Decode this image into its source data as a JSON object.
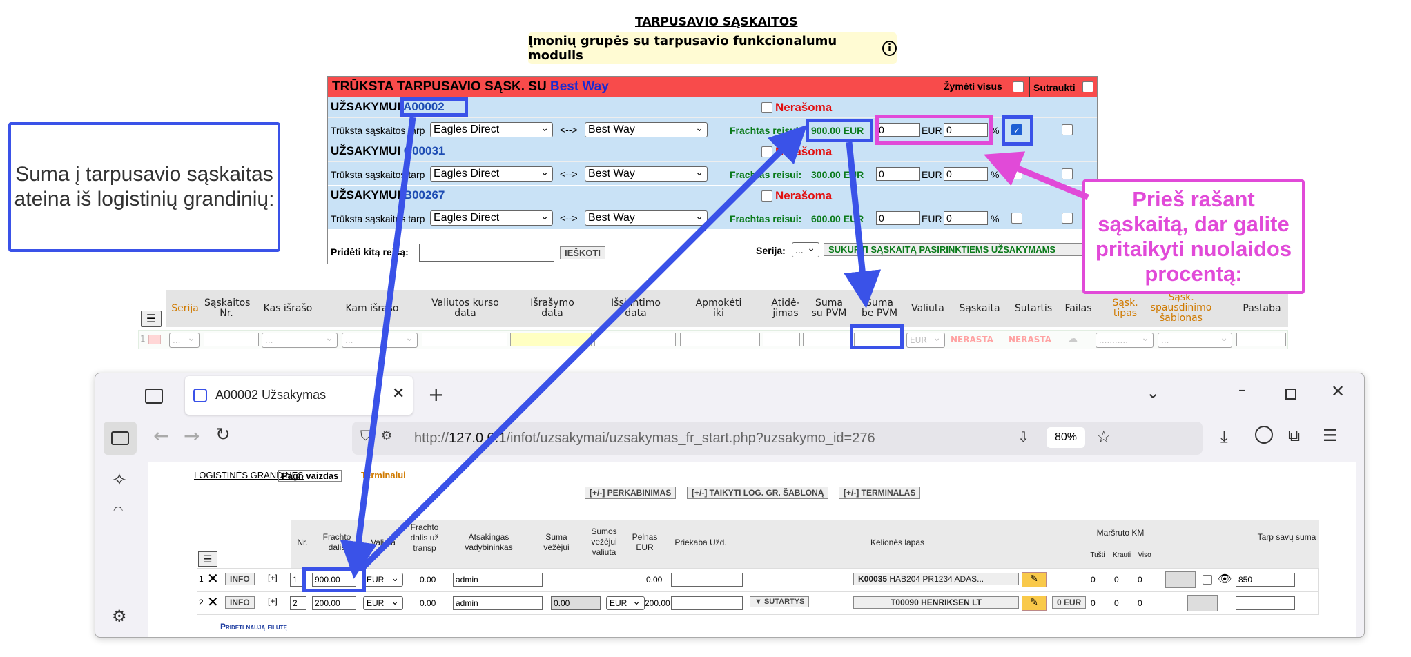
{
  "top": {
    "title": "TARPUSAVIO SĄSKAITOS",
    "notice": "Įmonių grupės su tarpusavio funkcionalumu modulis",
    "info_icon": "info-icon"
  },
  "panel": {
    "header_prefix": "TRŪKSTA TARPUSAVIO SĄSK. SU",
    "header_company": "Best Way",
    "mark_all": "Žymėti visus",
    "collapse": "Sutraukti",
    "orders": [
      {
        "label": "UŽSAKYMUI",
        "code": "A00002",
        "status": "Nerašoma",
        "row_label": "Trūksta sąskaitos tarp",
        "from": "Eagles Direct",
        "arrow": "<-->",
        "to": "Best Way",
        "freight_label": "Frachtas reisui:",
        "freight_value": "900.00 EUR",
        "eur_value": "0",
        "eur_unit": "EUR",
        "pct_value": "0",
        "pct_unit": "%",
        "checked": true
      },
      {
        "label": "UŽSAKYMUI",
        "code": "C00031",
        "status": "Nerašoma",
        "row_label": "Trūksta sąskaitos tarp",
        "from": "Eagles Direct",
        "arrow": "<-->",
        "to": "Best Way",
        "freight_label": "Frachtas reisui:",
        "freight_value": "300.00 EUR",
        "eur_value": "0",
        "eur_unit": "EUR",
        "pct_value": "0",
        "pct_unit": "%",
        "checked": false
      },
      {
        "label": "UŽSAKYMUI",
        "code": "B00267",
        "status": "Nerašoma",
        "row_label": "Trūksta sąskaitos tarp",
        "from": "Eagles Direct",
        "arrow": "<-->",
        "to": "Best Way",
        "freight_label": "Frachtas reisui:",
        "freight_value": "600.00 EUR",
        "eur_value": "0",
        "eur_unit": "EUR",
        "pct_value": "0",
        "pct_unit": "%",
        "checked": false
      }
    ],
    "add_trip_label": "Pridėti kitą reisą:",
    "search_button": "IEŠKOTI",
    "series_label": "Serija:",
    "series_value": "...",
    "create_button": "SUKURTI SĄSKAITĄ PASIRINKTIEMS UŽSAKYMAMS"
  },
  "invoice_table": {
    "columns": [
      "Serija",
      "Sąskaitos Nr.",
      "Kas išrašo",
      "Kam išrašo",
      "Valiutos kurso data",
      "Išrašymo data",
      "Išsiuntimo data",
      "Apmokėti iki",
      "Atidė- jimas",
      "Suma su PVM",
      "Suma be PVM",
      "Valiuta",
      "Sąskaita",
      "Sutartis",
      "Failas",
      "Sąsk. tipas",
      "Sąsk. spausdinimo šablonas",
      "Pastaba"
    ],
    "row_num": "1",
    "series_val": "...",
    "who_val": "...",
    "to_val": "...",
    "currency_val": "EUR",
    "account_val": "NERASTA",
    "contract_val": "NERASTA",
    "type_val": "...........",
    "template_val": "..."
  },
  "browser": {
    "tab_title": "A00002 Užsakymas",
    "url_prefix": "http://",
    "url_host": "127.0.0.1",
    "url_path": "/infot/uzsakymai/uzsakymas_fr_start.php?uzsakymo_id=276",
    "zoom": "80%"
  },
  "logistics": {
    "label": "LOGISTINĖS GRANDINĖS",
    "view_button": "Pagr. vaizdas",
    "terminals_link": "Terminalui",
    "buttons": [
      "[+/-] PERKABINIMAS",
      "[+/-] TAIKYTI LOG. GR. ŠABLONĄ",
      "[+/-] TERMINALAS"
    ],
    "columns": [
      "Nr.",
      "Frachto dalis",
      "Valiuta",
      "Frachto dalis už transp",
      "Atsakingas vadybininkas",
      "Suma vežėjui",
      "Sumos vežėjui valiuta",
      "Pelnas EUR",
      "Priekaba Užd.",
      "",
      "Kelionės lapas",
      "",
      "Maršruto KM",
      "",
      "Tarp savų suma"
    ],
    "km_sub": [
      "Tušti",
      "Krauti",
      "Viso"
    ],
    "rows": [
      {
        "idx": "1",
        "info": "INFO",
        "plus": "[+]",
        "nr": "1",
        "freight": "900.00",
        "currency": "EUR",
        "transp": "0.00",
        "manager": "admin",
        "carrier_sum": "",
        "carrier_cur": "",
        "profit": "0.00",
        "trailer": "",
        "contracts": "",
        "trip_code": "K00035",
        "trip_text": "HAB204 PR1234 ADAS...",
        "zero_eur": "",
        "km": [
          "0",
          "0",
          "0"
        ],
        "between": "850"
      },
      {
        "idx": "2",
        "info": "INFO",
        "plus": "[+]",
        "nr": "2",
        "freight": "200.00",
        "currency": "EUR",
        "transp": "0.00",
        "manager": "admin",
        "carrier_sum": "0.00",
        "carrier_cur": "EUR",
        "profit": "200.00",
        "trailer": "",
        "contracts": "▼ SUTARTYS",
        "trip_code": "T00090",
        "trip_text": "HENRIKSEN LT",
        "zero_eur": "0 EUR",
        "km": [
          "0",
          "0",
          "0"
        ],
        "between": ""
      }
    ],
    "add_row": "Pridėti naują eilutę"
  },
  "callouts": {
    "left": "Suma į tarpusavio sąskaitas ateina iš logistinių grandinių:",
    "right": "Prieš rašant sąskaitą, dar galite pritaikyti nuolaidos procentą:"
  },
  "colors": {
    "accent_blue": "#3a52e8",
    "accent_pink": "#e14ad8",
    "header_red": "#f84b4b",
    "row_blue": "#c9e2f6"
  }
}
